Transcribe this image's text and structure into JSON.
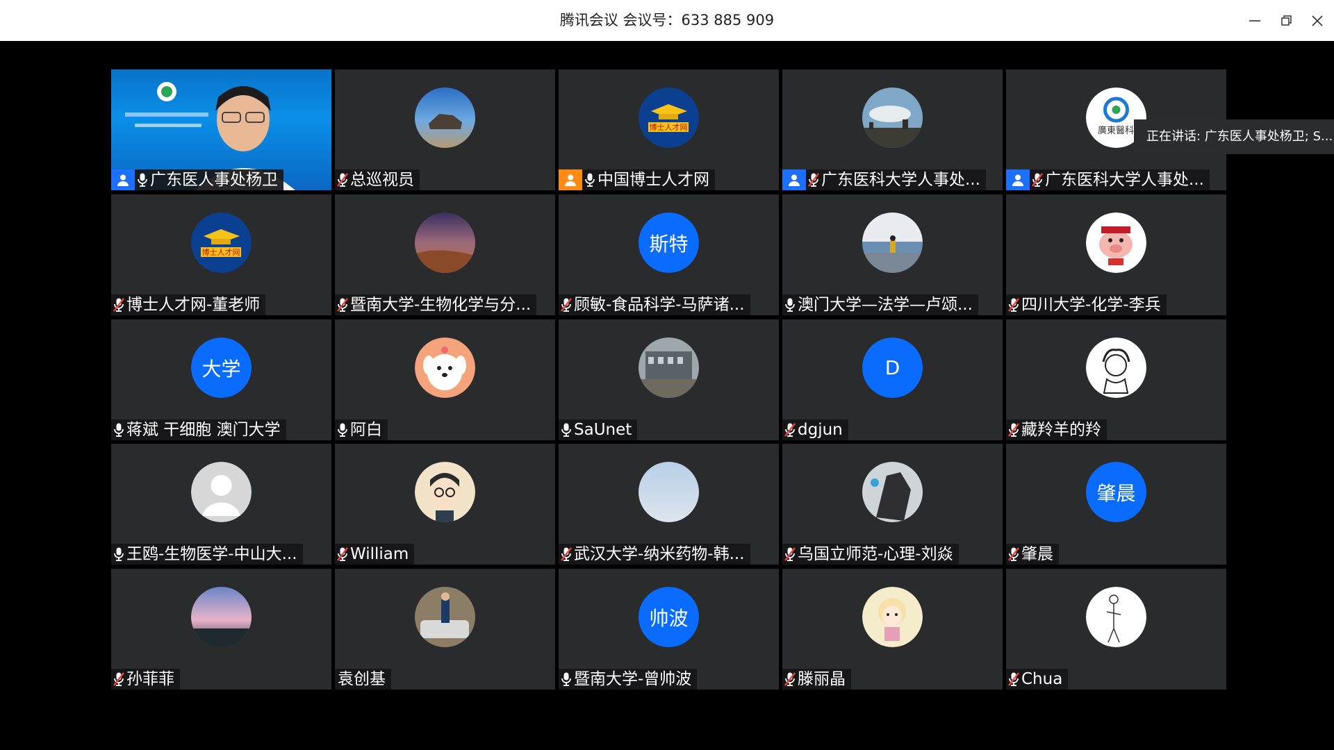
{
  "window": {
    "title": "腾讯会议 会议号：633 885 909",
    "buttons": [
      "minimize",
      "restore",
      "close"
    ]
  },
  "speaking_indicator": "正在讲话: 广东医人事处杨卫; S...",
  "colors": {
    "tile_bg": "#2a2b2d",
    "accent": "#1d6fff",
    "active_border": "#1fb45a",
    "mic_muted": "#e8453c"
  },
  "participants": [
    {
      "name": "广东医人事处杨卫",
      "mic": "on",
      "badge": "host-blue",
      "avatar": "video",
      "active": true
    },
    {
      "name": "总巡视员",
      "mic": "muted",
      "avatar": "rock-landscape"
    },
    {
      "name": "中国博士人才网",
      "mic": "on",
      "badge": "cohost-orange",
      "avatar": "boshi-logo"
    },
    {
      "name": "广东医科大学人事处...",
      "mic": "muted",
      "badge": "host-blue",
      "avatar": "sky-city"
    },
    {
      "name": "广东医科大学人事处...",
      "mic": "muted",
      "badge": "host-blue",
      "avatar": "gdmu-logo"
    },
    {
      "name": "博士人才网-董老师",
      "mic": "muted",
      "avatar": "boshi-logo"
    },
    {
      "name": "暨南大学-生物化学与分...",
      "mic": "muted",
      "avatar": "desert-night"
    },
    {
      "name": "顾敏-食品科学-马萨诸...",
      "mic": "muted",
      "avatar": "text",
      "avatar_text": "斯特"
    },
    {
      "name": "澳门大学—法学—卢颂...",
      "mic": "on",
      "avatar": "beach-girl"
    },
    {
      "name": "四川大学-化学-李兵",
      "mic": "muted",
      "avatar": "pig-cartoon"
    },
    {
      "name": "蒋斌 干细胞 澳门大学",
      "mic": "on",
      "avatar": "text",
      "avatar_text": "大学"
    },
    {
      "name": "阿白",
      "mic": "on",
      "avatar": "dog-cartoon"
    },
    {
      "name": "SaUnet",
      "mic": "on",
      "avatar": "building"
    },
    {
      "name": "dgjun",
      "mic": "muted",
      "avatar": "text",
      "avatar_text": "D"
    },
    {
      "name": "藏羚羊的羚",
      "mic": "muted",
      "avatar": "sketch-girl"
    },
    {
      "name": "王鸥-生物医学-中山大...",
      "mic": "on",
      "avatar": "default-person"
    },
    {
      "name": "William",
      "mic": "muted",
      "avatar": "glasses-cartoon"
    },
    {
      "name": "武汉大学-纳米药物-韩...",
      "mic": "muted",
      "avatar": "light-sky"
    },
    {
      "name": "乌国立师范-心理-刘焱",
      "mic": "muted",
      "avatar": "dark-art"
    },
    {
      "name": "肇晨",
      "mic": "muted",
      "avatar": "text",
      "avatar_text": "肇晨"
    },
    {
      "name": "孙菲菲",
      "mic": "muted",
      "avatar": "sunset"
    },
    {
      "name": "袁创基",
      "mic": "none",
      "avatar": "man-car"
    },
    {
      "name": "暨南大学-曾帅波",
      "mic": "on",
      "avatar": "text",
      "avatar_text": "帅波"
    },
    {
      "name": "滕丽晶",
      "mic": "muted",
      "avatar": "anime-girl"
    },
    {
      "name": "Chua",
      "mic": "muted",
      "avatar": "sketch-figure"
    }
  ]
}
